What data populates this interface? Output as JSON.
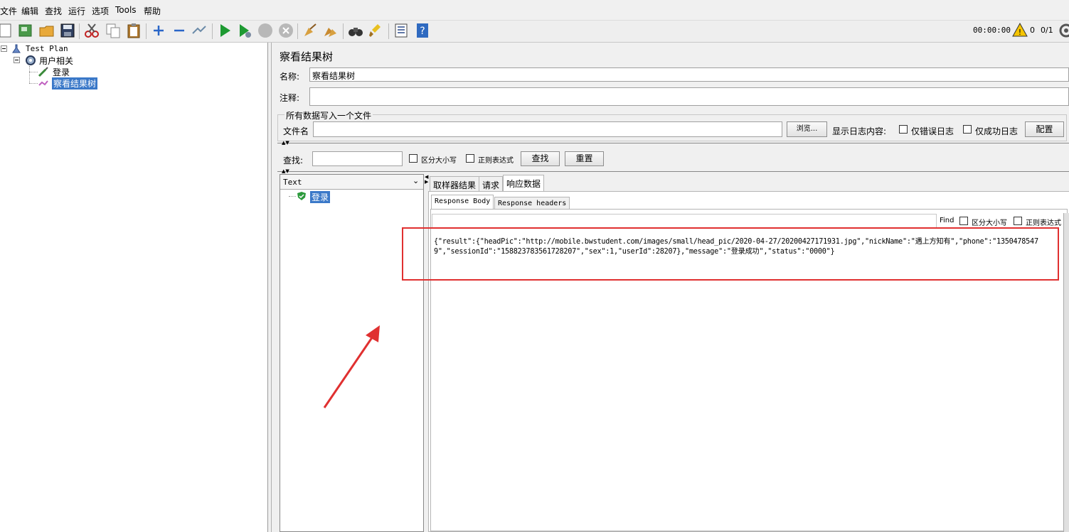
{
  "menu": {
    "file": "文件",
    "edit": "编辑",
    "find": "查找",
    "run": "运行",
    "options": "选项",
    "tools": "Tools",
    "help": "帮助"
  },
  "toolbar": {
    "timer": "00:00:00",
    "warnings": "0",
    "threads": "0/1"
  },
  "tree": {
    "plan": "Test Plan",
    "thread_group": "用户相关",
    "sampler": "登录",
    "listener": "察看结果树"
  },
  "panel": {
    "title": "察看结果树",
    "name_label": "名称:",
    "name_value": "察看结果树",
    "comment_label": "注释:",
    "comment_value": "",
    "write_section": "所有数据写入一个文件",
    "filename_label": "文件名",
    "filename_value": "",
    "browse": "浏览...",
    "log_label": "显示日志内容:",
    "errors_only": "仅错误日志",
    "success_only": "仅成功日志",
    "configure": "配置",
    "search_label": "查找:",
    "search_value": "",
    "case_sensitive": "区分大小写",
    "regex": "正则表达式",
    "search_btn": "查找",
    "reset_btn": "重置"
  },
  "results": {
    "renderer": "Text",
    "sample_label": "登录",
    "tabs": [
      "取样器结果",
      "请求",
      "响应数据"
    ],
    "subtabs": [
      "Response Body",
      "Response headers"
    ],
    "find_label": "Find",
    "find_value": "",
    "find_case": "区分大小写",
    "find_regex": "正则表达式",
    "response_line1": "{\"result\":{\"headPic\":\"http://mobile.bwstudent.com/images/small/head_pic/2020-04-27/20200427171931.jpg\",\"nickName\":\"遇上方知有\",\"phone\":\"1350478547",
    "response_line2": "9\",\"sessionId\":\"158823783561728207\",\"sex\":1,\"userId\":28207},\"message\":\"登录成功\",\"status\":\"0000\"}"
  },
  "colors": {
    "highlight_box": "#e03030",
    "arrow": "#e03030",
    "selection": "#3a78c8"
  }
}
